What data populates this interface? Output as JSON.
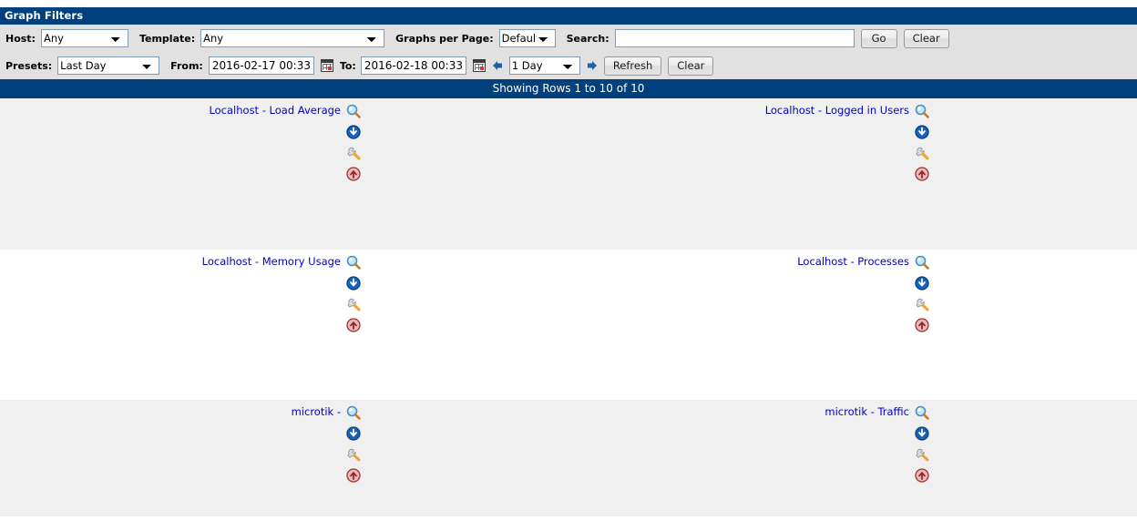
{
  "panel": {
    "title": "Graph Filters"
  },
  "filters": {
    "host_label": "Host:",
    "host_value": "Any",
    "host_options": [
      "Any"
    ],
    "template_label": "Template:",
    "template_value": "Any",
    "template_options": [
      "Any"
    ],
    "graphs_per_page_label": "Graphs per Page:",
    "graphs_per_page_value": "Default",
    "graphs_per_page_options": [
      "Default"
    ],
    "search_label": "Search:",
    "search_value": "",
    "search_placeholder": "",
    "go_label": "Go",
    "clear_label": "Clear",
    "presets_label": "Presets:",
    "presets_value": "Last Day",
    "presets_options": [
      "Last Day"
    ],
    "from_label": "From:",
    "from_value": "2016-02-17 00:33",
    "to_label": "To:",
    "to_value": "2016-02-18 00:33",
    "span_value": "1 Day",
    "span_options": [
      "1 Day"
    ],
    "refresh_label": "Refresh",
    "clear2_label": "Clear",
    "calendar_from_icon": "calendar-icon",
    "calendar_to_icon": "calendar-icon",
    "prev_icon": "arrow-left-icon",
    "next_icon": "arrow-right-icon"
  },
  "results": {
    "rows_header": "Showing Rows 1 to 10 of 10"
  },
  "graph_icons": [
    {
      "name": "zoom-icon",
      "title": "Zoom Graph"
    },
    {
      "name": "csv-export-icon",
      "title": "Export Graph Data to CSV"
    },
    {
      "name": "graph-properties-icon",
      "title": "Graph Properties"
    },
    {
      "name": "page-top-icon",
      "title": "Page Top"
    }
  ],
  "graphs": [
    {
      "title": "Localhost - Load Average"
    },
    {
      "title": "Localhost - Logged in Users"
    },
    {
      "title": "Localhost - Memory Usage"
    },
    {
      "title": "Localhost - Processes"
    },
    {
      "title": "microtik - "
    },
    {
      "title": "microtik - Traffic"
    }
  ],
  "colors": {
    "header_blue": "#00407d",
    "filter_bg": "#e1e1e1",
    "row_shade": "#f0f0f0",
    "link_blue": "#0000cc"
  }
}
